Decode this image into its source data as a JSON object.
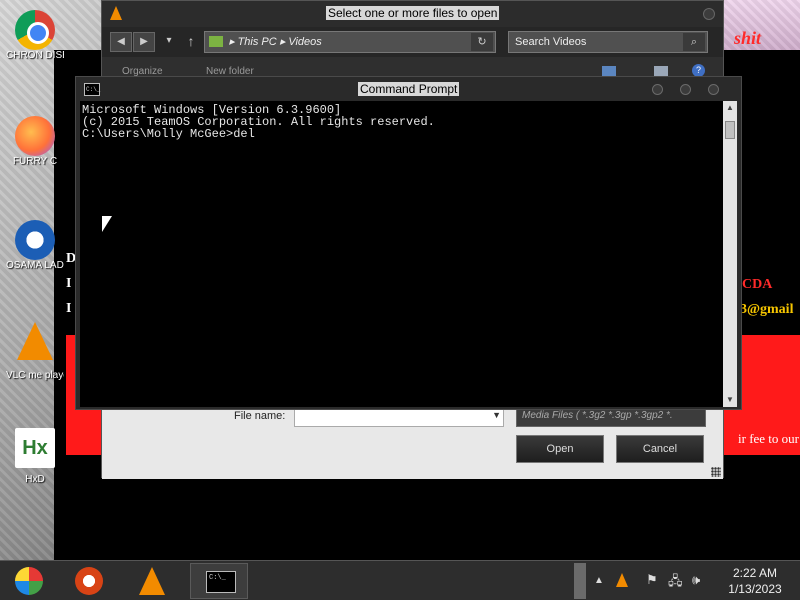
{
  "desktop": {
    "icons": [
      {
        "label": "CHRON DISEA",
        "icon": "chrome-icon"
      },
      {
        "label": "FURRY C",
        "icon": "firefox-icon"
      },
      {
        "label": "OSAMA LADEN",
        "icon": "obama-logo-icon"
      },
      {
        "label": "VLC me playe",
        "icon": "vlc-icon"
      },
      {
        "label": "HxD",
        "icon": "hxd-icon"
      }
    ]
  },
  "background_app": {
    "text_d": "D",
    "text_i1": "I",
    "text_i2": "I",
    "text_cda": "CDA",
    "text_gmail": "3@gmail",
    "text_fee": "ir fee to our",
    "text_shit": "shit"
  },
  "file_dialog": {
    "title": "Select one or more files to open",
    "address": [
      "This PC",
      "Videos"
    ],
    "search_placeholder": "Search Videos",
    "toolbar": {
      "organize": "Organize",
      "new_folder": "New folder"
    },
    "file_name_label": "File name:",
    "file_name_value": "",
    "file_type": "Media Files ( *.3g2 *.3gp *.3gp2 *.",
    "open_label": "Open",
    "cancel_label": "Cancel"
  },
  "cmd": {
    "title": "Command Prompt",
    "lines": [
      "Microsoft Windows [Version 6.3.9600]",
      "(c) 2015 TeamOS Corporation. All rights reserved.",
      "",
      "C:\\Users\\Molly McGee>del"
    ]
  },
  "taskbar": {
    "apps": [
      "start-orb-icon",
      "picasa-icon",
      "vlc-icon",
      "command-prompt-icon"
    ],
    "active": "command-prompt-icon",
    "tray": [
      "vlc-tray-icon",
      "flag-icon",
      "network-icon",
      "volume-icon"
    ],
    "time": "2:22 AM",
    "date": "1/13/2023"
  }
}
